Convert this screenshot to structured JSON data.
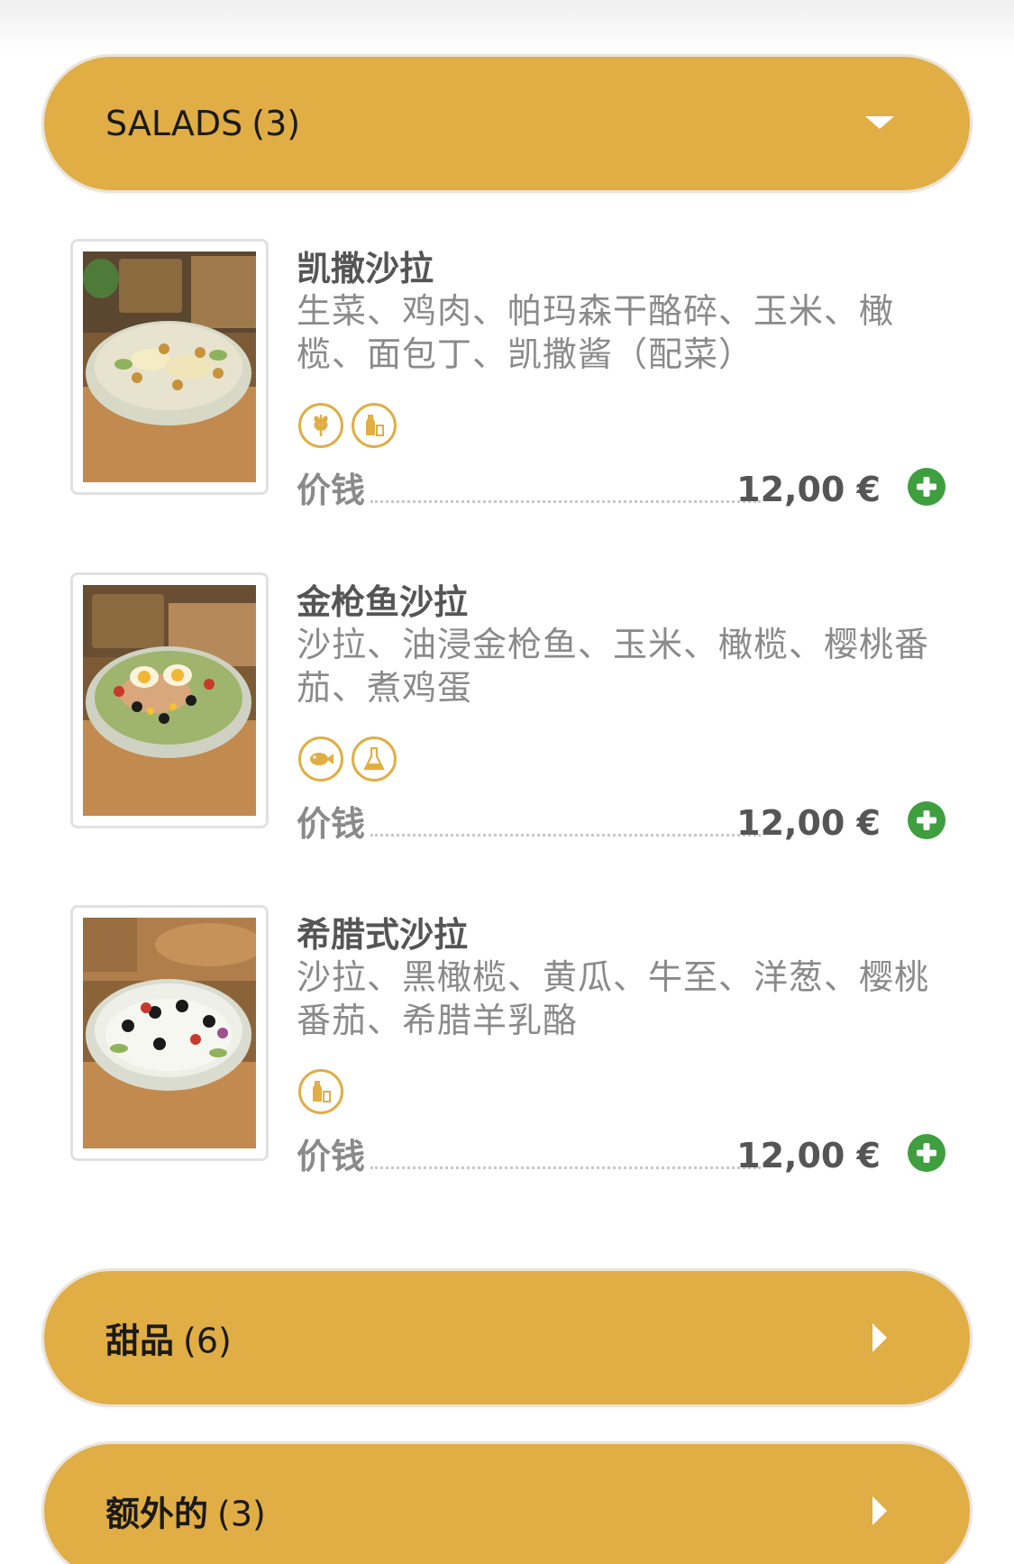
{
  "categories": [
    {
      "name": "SALADS",
      "count": "(3)",
      "state": "expanded",
      "arrow_icon": "triangle-down-icon"
    },
    {
      "name": "甜品",
      "count": "(6)",
      "state": "collapsed",
      "arrow_icon": "triangle-right-icon"
    },
    {
      "name": "额外的",
      "count": "(3)",
      "state": "collapsed",
      "arrow_icon": "triangle-right-icon"
    }
  ],
  "items": [
    {
      "title": "凯撒沙拉",
      "description": "生菜、鸡肉、帕玛森干酪碎、玉米、橄榄、面包丁、凯撒酱（配菜）",
      "allergens": [
        "gluten-wheat-icon",
        "milk-icon"
      ],
      "price_label": "价钱",
      "price": "12,00 €"
    },
    {
      "title": "金枪鱼沙拉",
      "description": "沙拉、油浸金枪鱼、玉米、橄榄、樱桃番茄、煮鸡蛋",
      "allergens": [
        "fish-icon",
        "sulphites-icon"
      ],
      "price_label": "价钱",
      "price": "12,00 €"
    },
    {
      "title": "希腊式沙拉",
      "description": "沙拉、黑橄榄、黄瓜、牛至、洋葱、樱桃番茄、希腊羊乳酪",
      "allergens": [
        "milk-icon"
      ],
      "price_label": "价钱",
      "price": "12,00 €"
    }
  ],
  "colors": {
    "category_bg": "#e0ae45",
    "add_button": "#3f9f3f",
    "title_text": "#555555",
    "desc_text": "#8a8a8a"
  }
}
